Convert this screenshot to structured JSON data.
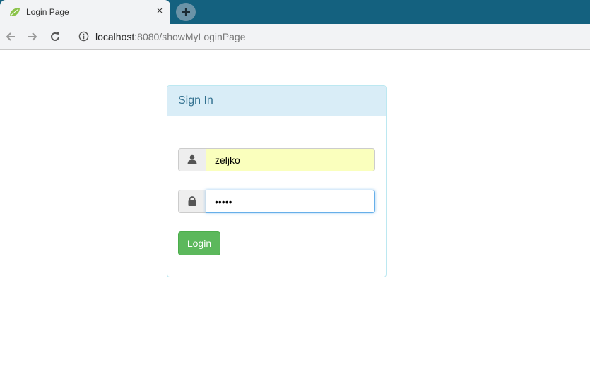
{
  "browser": {
    "tab_title": "Login Page",
    "tab_close": "×",
    "url_host": "localhost",
    "url_rest": ":8080/showMyLoginPage",
    "accent_color": "#14617f"
  },
  "panel": {
    "title": "Sign In",
    "heading_bg": "#d9edf7"
  },
  "form": {
    "username_value": "zeljko",
    "password_value": "•••••",
    "login_label": "Login",
    "login_color": "#5cb85c"
  },
  "icons": {
    "user": "user-icon",
    "lock": "lock-icon",
    "back": "back-arrow-icon",
    "forward": "forward-arrow-icon",
    "reload": "reload-icon",
    "info": "info-icon",
    "favicon": "spring-leaf-icon",
    "new_tab": "plus-icon"
  }
}
